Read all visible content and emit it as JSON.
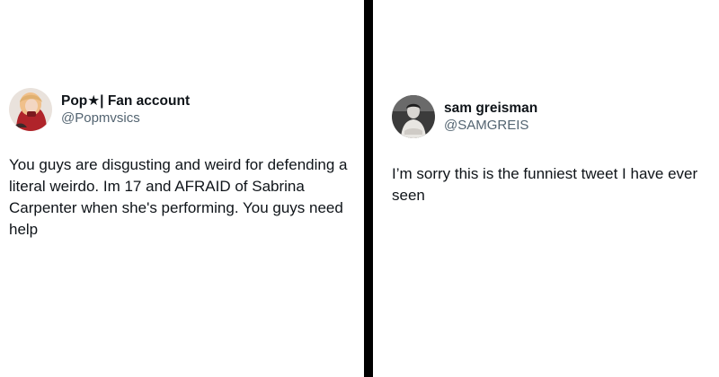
{
  "tweets": [
    {
      "display_name": "Pop★| Fan account",
      "handle": "@Popmvsics",
      "text": "You guys are disgusting and weird for defending a literal weirdo. Im 17 and AFRAID of Sabrina Carpenter when she's performing. You guys need help",
      "avatar_icon": "profile-photo-icon"
    },
    {
      "display_name": "sam greisman",
      "handle": "@SAMGREIS",
      "text": "I’m sorry this is the funniest tweet I have ever seen",
      "avatar_icon": "profile-photo-icon"
    }
  ],
  "colors": {
    "text": "#0f1419",
    "handle": "#536471",
    "divider": "#000000",
    "background": "#ffffff"
  }
}
